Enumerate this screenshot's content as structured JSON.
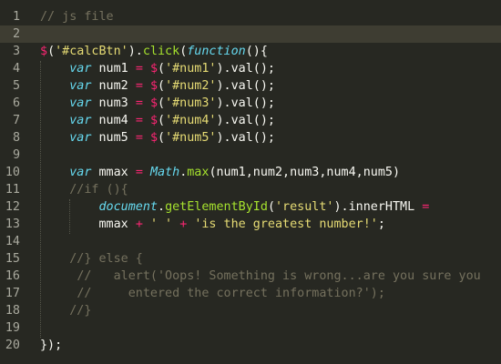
{
  "editor": {
    "language": "javascript",
    "theme": "monokai",
    "current_line": 2,
    "colors": {
      "background": "#272822",
      "current_line": "#3e3d32",
      "comment": "#75715e",
      "string": "#e6db74",
      "keyword": "#66d9ef",
      "operator": "#f92672",
      "function": "#a6e22e",
      "plain": "#f8f8f2"
    },
    "lines": [
      {
        "number": "1",
        "tokens": [
          {
            "t": "comment",
            "text": "// js file"
          }
        ]
      },
      {
        "number": "2",
        "tokens": []
      },
      {
        "number": "3",
        "tokens": [
          {
            "t": "op",
            "text": "$"
          },
          {
            "t": "plain",
            "text": "("
          },
          {
            "t": "str",
            "text": "'#calcBtn'"
          },
          {
            "t": "plain",
            "text": ")."
          },
          {
            "t": "fn",
            "text": "click"
          },
          {
            "t": "plain",
            "text": "("
          },
          {
            "t": "kw",
            "text": "function"
          },
          {
            "t": "plain",
            "text": "(){"
          }
        ]
      },
      {
        "number": "4",
        "tokens": [
          {
            "t": "plain",
            "text": "    "
          },
          {
            "t": "kw",
            "text": "var"
          },
          {
            "t": "plain",
            "text": " num1 "
          },
          {
            "t": "op",
            "text": "="
          },
          {
            "t": "plain",
            "text": " "
          },
          {
            "t": "op",
            "text": "$"
          },
          {
            "t": "plain",
            "text": "("
          },
          {
            "t": "str",
            "text": "'#num1'"
          },
          {
            "t": "plain",
            "text": ").val();"
          }
        ]
      },
      {
        "number": "5",
        "tokens": [
          {
            "t": "plain",
            "text": "    "
          },
          {
            "t": "kw",
            "text": "var"
          },
          {
            "t": "plain",
            "text": " num2 "
          },
          {
            "t": "op",
            "text": "="
          },
          {
            "t": "plain",
            "text": " "
          },
          {
            "t": "op",
            "text": "$"
          },
          {
            "t": "plain",
            "text": "("
          },
          {
            "t": "str",
            "text": "'#num2'"
          },
          {
            "t": "plain",
            "text": ").val();"
          }
        ]
      },
      {
        "number": "6",
        "tokens": [
          {
            "t": "plain",
            "text": "    "
          },
          {
            "t": "kw",
            "text": "var"
          },
          {
            "t": "plain",
            "text": " num3 "
          },
          {
            "t": "op",
            "text": "="
          },
          {
            "t": "plain",
            "text": " "
          },
          {
            "t": "op",
            "text": "$"
          },
          {
            "t": "plain",
            "text": "("
          },
          {
            "t": "str",
            "text": "'#num3'"
          },
          {
            "t": "plain",
            "text": ").val();"
          }
        ]
      },
      {
        "number": "7",
        "tokens": [
          {
            "t": "plain",
            "text": "    "
          },
          {
            "t": "kw",
            "text": "var"
          },
          {
            "t": "plain",
            "text": " num4 "
          },
          {
            "t": "op",
            "text": "="
          },
          {
            "t": "plain",
            "text": " "
          },
          {
            "t": "op",
            "text": "$"
          },
          {
            "t": "plain",
            "text": "("
          },
          {
            "t": "str",
            "text": "'#num4'"
          },
          {
            "t": "plain",
            "text": ").val();"
          }
        ]
      },
      {
        "number": "8",
        "tokens": [
          {
            "t": "plain",
            "text": "    "
          },
          {
            "t": "kw",
            "text": "var"
          },
          {
            "t": "plain",
            "text": " num5 "
          },
          {
            "t": "op",
            "text": "="
          },
          {
            "t": "plain",
            "text": " "
          },
          {
            "t": "op",
            "text": "$"
          },
          {
            "t": "plain",
            "text": "("
          },
          {
            "t": "str",
            "text": "'#num5'"
          },
          {
            "t": "plain",
            "text": ").val();"
          }
        ]
      },
      {
        "number": "9",
        "tokens": []
      },
      {
        "number": "10",
        "tokens": [
          {
            "t": "plain",
            "text": "    "
          },
          {
            "t": "kw",
            "text": "var"
          },
          {
            "t": "plain",
            "text": " mmax "
          },
          {
            "t": "op",
            "text": "="
          },
          {
            "t": "plain",
            "text": " "
          },
          {
            "t": "kw",
            "text": "Math"
          },
          {
            "t": "plain",
            "text": "."
          },
          {
            "t": "fn",
            "text": "max"
          },
          {
            "t": "plain",
            "text": "(num1,num2,num3,num4,num5)"
          }
        ]
      },
      {
        "number": "11",
        "tokens": [
          {
            "t": "plain",
            "text": "    "
          },
          {
            "t": "comment",
            "text": "//if (){"
          }
        ]
      },
      {
        "number": "12",
        "tokens": [
          {
            "t": "plain",
            "text": "        "
          },
          {
            "t": "kw",
            "text": "document"
          },
          {
            "t": "plain",
            "text": "."
          },
          {
            "t": "fn",
            "text": "getElementById"
          },
          {
            "t": "plain",
            "text": "("
          },
          {
            "t": "str",
            "text": "'result'"
          },
          {
            "t": "plain",
            "text": ").innerHTML "
          },
          {
            "t": "op",
            "text": "="
          }
        ]
      },
      {
        "number": "13",
        "tokens": [
          {
            "t": "plain",
            "text": "        mmax "
          },
          {
            "t": "op",
            "text": "+"
          },
          {
            "t": "plain",
            "text": " "
          },
          {
            "t": "str",
            "text": "' '"
          },
          {
            "t": "plain",
            "text": " "
          },
          {
            "t": "op",
            "text": "+"
          },
          {
            "t": "plain",
            "text": " "
          },
          {
            "t": "str",
            "text": "'is the greatest number!'"
          },
          {
            "t": "plain",
            "text": ";"
          }
        ]
      },
      {
        "number": "14",
        "tokens": []
      },
      {
        "number": "15",
        "tokens": [
          {
            "t": "plain",
            "text": "    "
          },
          {
            "t": "comment",
            "text": "//} else {"
          }
        ]
      },
      {
        "number": "16",
        "tokens": [
          {
            "t": "plain",
            "text": "     "
          },
          {
            "t": "comment",
            "text": "//   alert('Oops! Something is wrong...are you sure you"
          }
        ]
      },
      {
        "number": "17",
        "tokens": [
          {
            "t": "plain",
            "text": "     "
          },
          {
            "t": "comment",
            "text": "//     entered the correct information?');"
          }
        ]
      },
      {
        "number": "18",
        "tokens": [
          {
            "t": "plain",
            "text": "    "
          },
          {
            "t": "comment",
            "text": "//}"
          }
        ]
      },
      {
        "number": "19",
        "tokens": []
      },
      {
        "number": "20",
        "tokens": [
          {
            "t": "plain",
            "text": "});"
          }
        ]
      }
    ]
  }
}
